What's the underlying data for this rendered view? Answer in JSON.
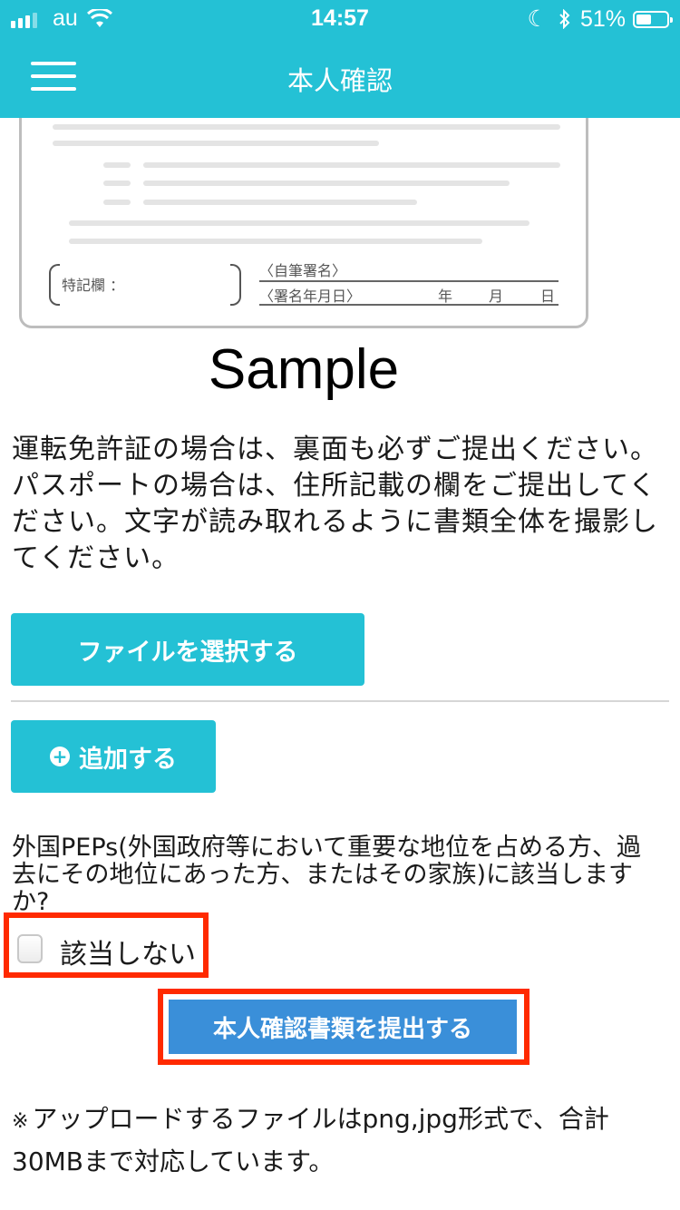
{
  "status_bar": {
    "carrier": "au",
    "time": "14:57",
    "battery": "51%",
    "battery_level": 0.51
  },
  "header": {
    "title": "本人確認"
  },
  "card": {
    "remarks_label": "特記欄 ：",
    "signature_label": "〈自筆署名〉",
    "sign_date_label": "〈署名年月日〉",
    "year": "年",
    "month": "月",
    "day": "日"
  },
  "sample_label": "Sample",
  "instructions": "運転免許証の場合は、裏面も必ずご提出ください。パスポートの場合は、住所記載の欄をご提出してください。文字が読み取れるように書類全体を撮影してください。",
  "buttons": {
    "select_file": "ファイルを選択する",
    "add": "追加する",
    "submit": "本人確認書類を提出する"
  },
  "peps": {
    "question": "外国PEPs(外国政府等において重要な地位を占める方、過去にその地位にあった方、またはその家族)に該当しますか?",
    "option_label": "該当しない",
    "checked": false
  },
  "note": {
    "mark": "※",
    "text": "アップロードするファイルはpng,jpg形式で、合計30MBまで対応しています。"
  },
  "colors": {
    "accent": "#24c1d5",
    "submit": "#3a8fd9",
    "highlight": "#ff2a00"
  }
}
